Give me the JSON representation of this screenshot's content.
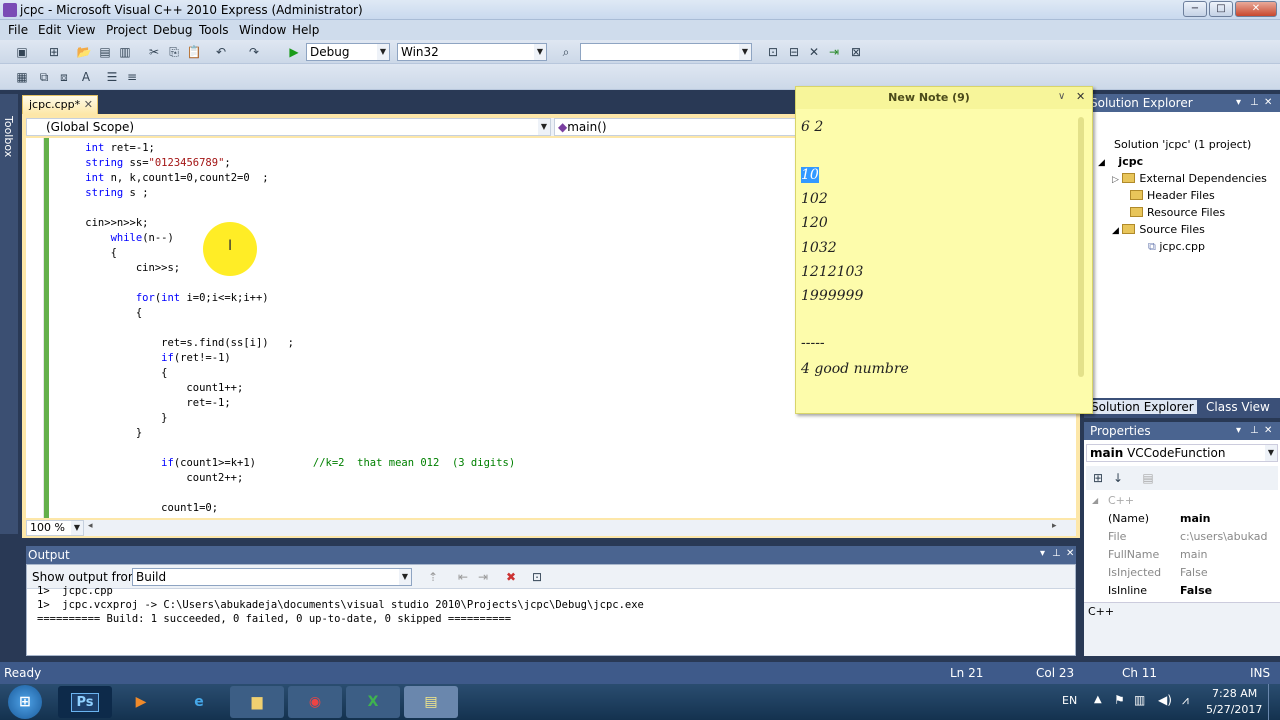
{
  "window": {
    "title": "jcpc - Microsoft Visual C++ 2010 Express (Administrator)",
    "minimize": "−",
    "restore": "□",
    "close": "✕"
  },
  "menu": [
    "File",
    "Edit",
    "View",
    "Project",
    "Debug",
    "Tools",
    "Window",
    "Help"
  ],
  "toolbar": {
    "config": "Debug",
    "platform": "Win32",
    "find": ""
  },
  "toolbox_label": "Toolbox",
  "doc_tab": {
    "label": "jcpc.cpp*",
    "close": "✕"
  },
  "scope": {
    "left": "(Global Scope)",
    "right": "main()"
  },
  "zoom": "100 %",
  "code_lines": [
    "    int ret=-1;",
    "    string ss=\"0123456789\";",
    "    int n, k,count1=0,count2=0  ;",
    "    string s ;",
    "",
    "    cin>>n>>k;",
    "        while(n--)",
    "        {",
    "            cin>>s;",
    "",
    "            for(int i=0;i<=k;i++)",
    "            {",
    "",
    "                ret=s.find(ss[i])   ;",
    "                if(ret!=-1)",
    "                {",
    "                    count1++;",
    "                    ret=-1;",
    "                }",
    "            }",
    "",
    "                if(count1>=k+1)         //k=2  that mean 012  (3 digits)",
    "                    count2++;",
    "",
    "                count1=0;"
  ],
  "output": {
    "title": "Output",
    "show_from_label": "Show output from:",
    "source": "Build",
    "lines": [
      "1>  jcpc.cpp",
      "1>  jcpc.vcxproj -> C:\\Users\\abukadeja\\documents\\visual studio 2010\\Projects\\jcpc\\Debug\\jcpc.exe",
      "========== Build: 1 succeeded, 0 failed, 0 up-to-date, 0 skipped =========="
    ]
  },
  "note": {
    "title": "New Note (9)",
    "lines": [
      "6  2",
      "",
      "10",
      "102",
      "120",
      "1032",
      "1212103",
      "1999999",
      "",
      "-----",
      "4 good numbre"
    ]
  },
  "solution_explorer": {
    "title": "Solution Explorer",
    "solution": "Solution 'jcpc' (1 project)",
    "project": "jcpc",
    "items": [
      "External Dependencies",
      "Header Files",
      "Resource Files",
      "Source Files"
    ],
    "file": "jcpc.cpp",
    "tabs": [
      "Solution Explorer",
      "Class View"
    ]
  },
  "properties": {
    "title": "Properties",
    "object": "main",
    "object_type": "VCCodeFunction",
    "category": "C++",
    "rows": [
      {
        "k": "(Name)",
        "v": "main"
      },
      {
        "k": "File",
        "v": "c:\\users\\abukadeja"
      },
      {
        "k": "FullName",
        "v": "main"
      },
      {
        "k": "IsInjected",
        "v": "False"
      },
      {
        "k": "IsInline",
        "v": "False"
      }
    ],
    "description": "C++"
  },
  "status": {
    "ready": "Ready",
    "ln": "Ln 21",
    "col": "Col 23",
    "ch": "Ch 11",
    "ins": "INS"
  },
  "taskbar": {
    "lang": "EN",
    "time": "7:28 AM",
    "date": "5/27/2017",
    "apps": [
      "start",
      "Ps",
      "media",
      "ie",
      "explorer",
      "chrome",
      "excel",
      "notes"
    ]
  }
}
